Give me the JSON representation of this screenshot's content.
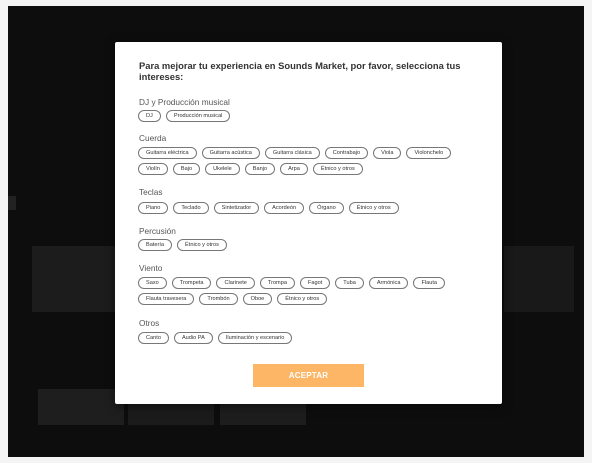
{
  "dialog": {
    "title": "Para mejorar tu experiencia en Sounds Market, por favor, selecciona tus intereses:",
    "sections": [
      {
        "label": "DJ y Producción musical",
        "options": [
          "DJ",
          "Producción musical"
        ]
      },
      {
        "label": "Cuerda",
        "options": [
          "Guitarra eléctrica",
          "Guitarra acústica",
          "Guitarra clásica",
          "Contrabajo",
          "Viola",
          "Violonchelo",
          "Violín",
          "Bajo",
          "Ukelele",
          "Banjo",
          "Arpa",
          "Étnico y otros"
        ]
      },
      {
        "label": "Teclas",
        "options": [
          "Piano",
          "Teclado",
          "Sintetizador",
          "Acordeón",
          "Órgano",
          "Étnico y otros"
        ]
      },
      {
        "label": "Percusión",
        "options": [
          "Batería",
          "Étnico y otros"
        ]
      },
      {
        "label": "Viento",
        "options": [
          "Saxo",
          "Trompeta",
          "Clarinete",
          "Trompa",
          "Fagot",
          "Tuba",
          "Armónica",
          "Flauta",
          "Flauta travesera",
          "Trombón",
          "Oboe",
          "Étnico y otros"
        ]
      },
      {
        "label": "Otros",
        "options": [
          "Canto",
          "Audio PA",
          "Iluminación y escenario"
        ]
      }
    ],
    "accept_label": "ACEPTAR"
  },
  "colors": {
    "accent": "#fcb665",
    "overlay": "#0d0d0d"
  }
}
